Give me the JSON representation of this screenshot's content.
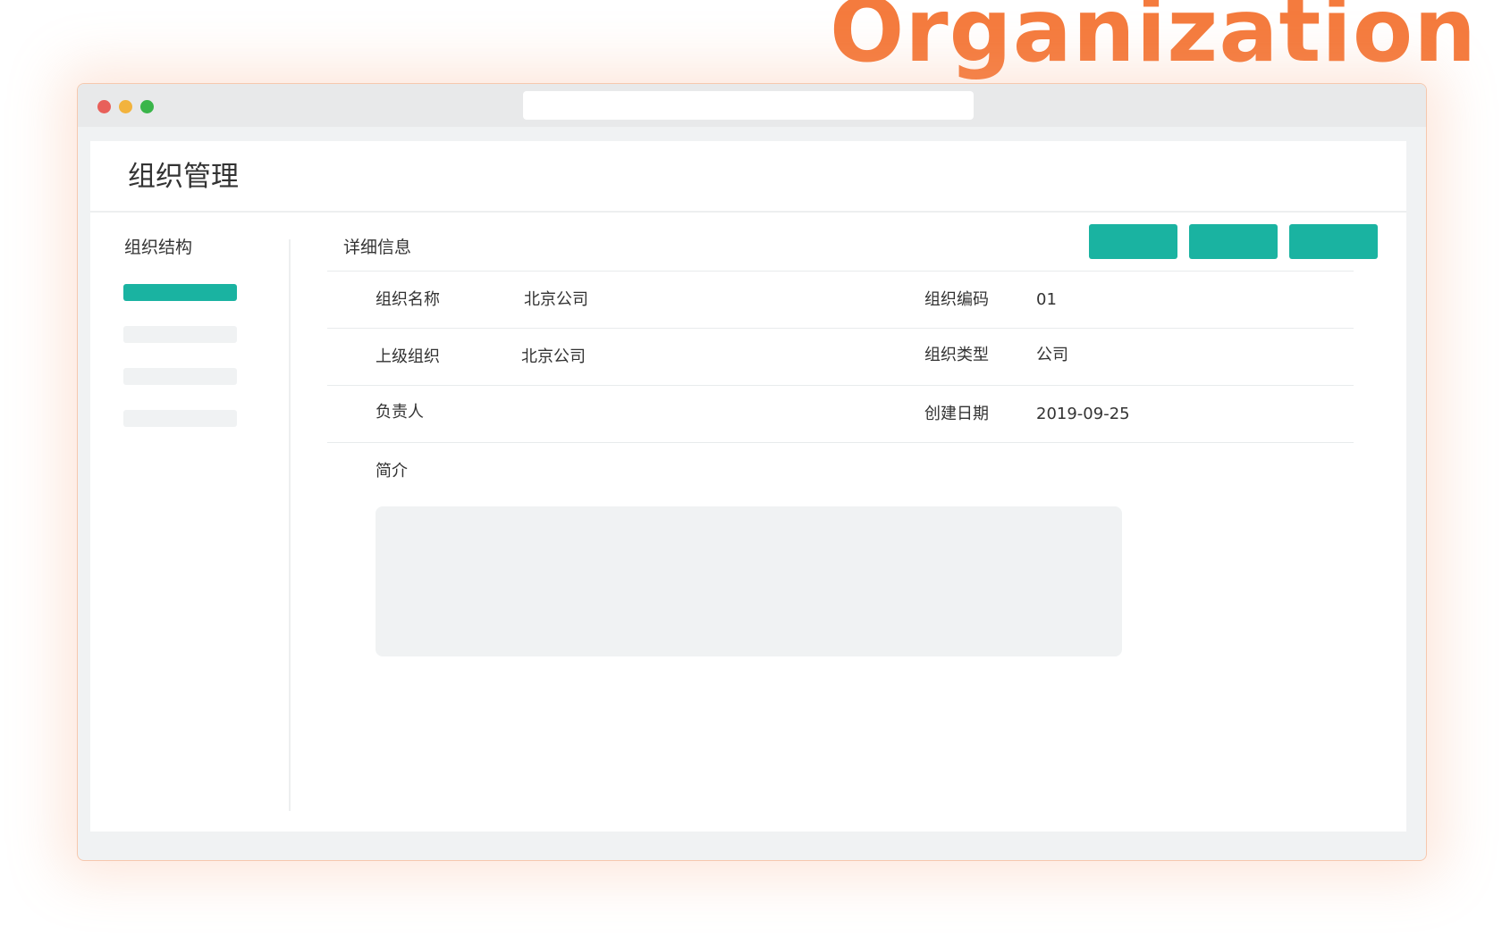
{
  "hero": {
    "title": "Organization"
  },
  "window": {
    "traffic_lights": [
      {
        "name": "close",
        "color": "#E8605A"
      },
      {
        "name": "minimize",
        "color": "#F2B33D"
      },
      {
        "name": "maximize",
        "color": "#3AB54A"
      }
    ],
    "address_bar": {
      "value": ""
    }
  },
  "page": {
    "title": "组织管理"
  },
  "sidebar": {
    "title": "组织结构",
    "items": [
      {
        "label": "",
        "selected": true
      },
      {
        "label": "",
        "selected": false
      },
      {
        "label": "",
        "selected": false
      },
      {
        "label": "",
        "selected": false
      }
    ]
  },
  "detail": {
    "title": "详细信息",
    "actions": [
      {
        "label": ""
      },
      {
        "label": ""
      },
      {
        "label": ""
      }
    ],
    "fields": {
      "org_name": {
        "label": "组织名称",
        "value": "北京公司"
      },
      "org_code": {
        "label": "组织编码",
        "value": "01"
      },
      "parent_org": {
        "label": "上级组织",
        "value": "北京公司"
      },
      "org_type": {
        "label": "组织类型",
        "value": "公司"
      },
      "manager": {
        "label": "负责人",
        "value": ""
      },
      "created_date": {
        "label": "创建日期",
        "value": "2019-09-25"
      }
    },
    "description": {
      "label": "简介",
      "value": ""
    }
  },
  "colors": {
    "accent": "#1AB3A1",
    "brand_orange": "#F47B3E",
    "placeholder_gray": "#F0F2F3"
  }
}
